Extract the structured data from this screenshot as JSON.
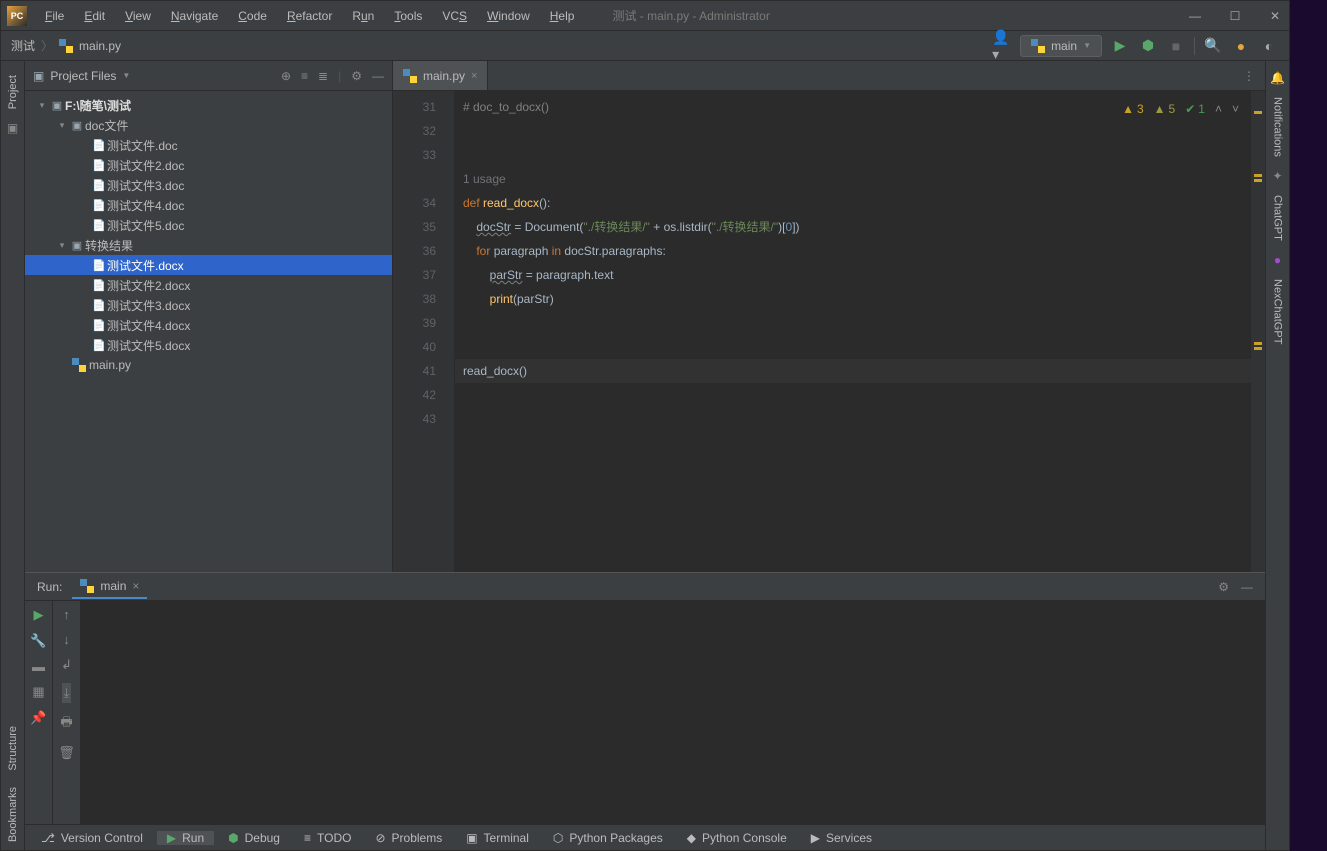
{
  "window": {
    "title": "测试 - main.py - Administrator"
  },
  "menu": [
    "File",
    "Edit",
    "View",
    "Navigate",
    "Code",
    "Refactor",
    "Run",
    "Tools",
    "VCS",
    "Window",
    "Help"
  ],
  "breadcrumb": {
    "root": "测试",
    "file": "main.py"
  },
  "runConfig": {
    "name": "main"
  },
  "project": {
    "selector": "Project Files",
    "root": "F:\\随笔\\测试",
    "folders": [
      {
        "name": "doc文件",
        "files": [
          "测试文件.doc",
          "测试文件2.doc",
          "测试文件3.doc",
          "测试文件4.doc",
          "测试文件5.doc"
        ]
      },
      {
        "name": "转换结果",
        "files": [
          "测试文件.docx",
          "测试文件2.docx",
          "测试文件3.docx",
          "测试文件4.docx",
          "测试文件5.docx"
        ]
      }
    ],
    "rootFile": "main.py",
    "selected": "测试文件.docx"
  },
  "editor": {
    "tab": "main.py",
    "inspections": {
      "warn1": "3",
      "warn2": "5",
      "ok": "1"
    },
    "usage": "1 usage",
    "lineStart": 31,
    "lineEnd": 43,
    "code": {
      "l31": "# doc_to_docx()",
      "l34_def": "def ",
      "l34_fn": "read_docx",
      "l34_rest": "():",
      "l35a": "    ",
      "l35var": "docStr",
      "l35b": " = Document(",
      "l35s1": "\"./转换结果/\"",
      "l35c": " + os.listdir(",
      "l35s2": "\"./转换结果/\"",
      "l35d": ")[",
      "l35n": "0",
      "l35e": "])",
      "l36a": "    ",
      "l36for": "for ",
      "l36b": "paragraph ",
      "l36in": "in ",
      "l36c": "docStr.paragraphs:",
      "l37a": "        ",
      "l37var": "parStr",
      "l37b": " = paragraph.text",
      "l38a": "        ",
      "l38fn": "print",
      "l38b": "(parStr)",
      "l41": "read_docx()"
    }
  },
  "runPanel": {
    "label": "Run:",
    "config": "main"
  },
  "toolWindows": {
    "left1": "Project",
    "left2": "Structure",
    "left3": "Bookmarks",
    "right1": "Notifications",
    "right2": "ChatGPT",
    "right3": "NexChatGPT"
  },
  "statusBar": [
    "Version Control",
    "Run",
    "Debug",
    "TODO",
    "Problems",
    "Terminal",
    "Python Packages",
    "Python Console",
    "Services"
  ]
}
